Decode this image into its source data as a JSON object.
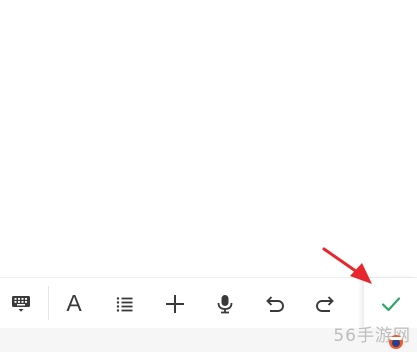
{
  "toolbar": {
    "items": [
      {
        "icon": "keyboard-icon"
      },
      {
        "icon": "text-format-icon",
        "glyph": "A"
      },
      {
        "icon": "list-icon"
      },
      {
        "icon": "add-icon"
      },
      {
        "icon": "microphone-icon"
      },
      {
        "icon": "undo-icon"
      },
      {
        "icon": "redo-icon"
      }
    ],
    "confirm_icon": "checkmark-icon"
  },
  "annotation": {
    "icon": "red-arrow-icon",
    "color": "#e8262d"
  },
  "watermark": {
    "text": "56手游网"
  },
  "colors": {
    "icon": "#3a3a3a",
    "confirm": "#2ea866",
    "arrow": "#e8262d"
  }
}
